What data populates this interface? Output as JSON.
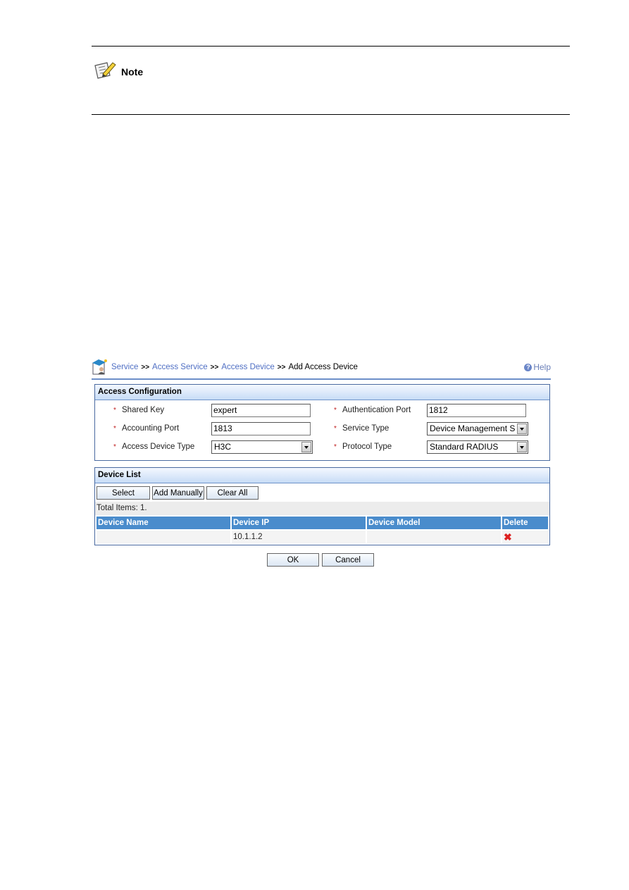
{
  "note": {
    "label": "Note",
    "icon": "note-pencil-icon"
  },
  "breadcrumb": {
    "items": [
      "Service",
      "Access Service",
      "Access Device"
    ],
    "separator": ">>",
    "current": "Add Access Device",
    "help": "Help"
  },
  "access_config": {
    "title": "Access Configuration",
    "required_mark": "*",
    "shared_key": {
      "label": "Shared Key",
      "value": "expert"
    },
    "accounting_port": {
      "label": "Accounting Port",
      "value": "1813"
    },
    "access_device_type": {
      "label": "Access Device Type",
      "value": "H3C"
    },
    "authentication_port": {
      "label": "Authentication Port",
      "value": "1812"
    },
    "service_type": {
      "label": "Service Type",
      "value": "Device Management S"
    },
    "protocol_type": {
      "label": "Protocol Type",
      "value": "Standard RADIUS"
    }
  },
  "device_list": {
    "title": "Device List",
    "buttons": {
      "select": "Select",
      "add_manually": "Add Manually",
      "clear_all": "Clear All"
    },
    "total": "Total Items: 1.",
    "columns": [
      "Device Name",
      "Device IP",
      "Device Model",
      "Delete"
    ],
    "rows": [
      {
        "name": "",
        "ip": "10.1.1.2",
        "model": "",
        "delete": "✖"
      }
    ]
  },
  "actions": {
    "ok": "OK",
    "cancel": "Cancel"
  }
}
